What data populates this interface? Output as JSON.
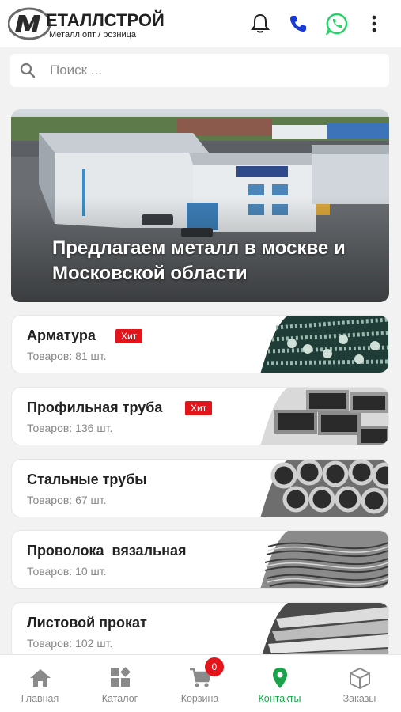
{
  "header": {
    "logo_title": "ЕТАЛЛСТРОЙ",
    "logo_subtitle": "Металл опт / розница",
    "icons": [
      "bell-icon",
      "phone-icon",
      "whatsapp-icon",
      "more-vertical-icon"
    ]
  },
  "search": {
    "placeholder": "Поиск ..."
  },
  "banner": {
    "text": "Предлагаем металл в москве и Московской области"
  },
  "categories": [
    {
      "title": "Арматура",
      "count": "Товаров: 81 шт.",
      "badge": "Хит"
    },
    {
      "title": "Профильная труба",
      "count": "Товаров: 136 шт.",
      "badge": "Хит"
    },
    {
      "title": "Стальные трубы",
      "count": "Товаров: 67 шт."
    },
    {
      "title": "Проволока  вязальная",
      "count": "Товаров: 10 шт."
    },
    {
      "title": "Листовой прокат",
      "count": "Товаров: 102 шт."
    }
  ],
  "tabbar": {
    "items": [
      {
        "label": "Главная",
        "icon": "home-icon"
      },
      {
        "label": "Каталог",
        "icon": "catalog-icon"
      },
      {
        "label": "Корзина",
        "icon": "cart-icon"
      },
      {
        "label": "Контакты",
        "icon": "location-pin-icon"
      },
      {
        "label": "Заказы",
        "icon": "box-icon"
      }
    ],
    "active": "Контакты",
    "cart_count": "0"
  },
  "colors": {
    "accent_green": "#1aa34a",
    "badge_red": "#e4141b",
    "phone_blue": "#1a3ad6",
    "whatsapp_green": "#25d366"
  }
}
